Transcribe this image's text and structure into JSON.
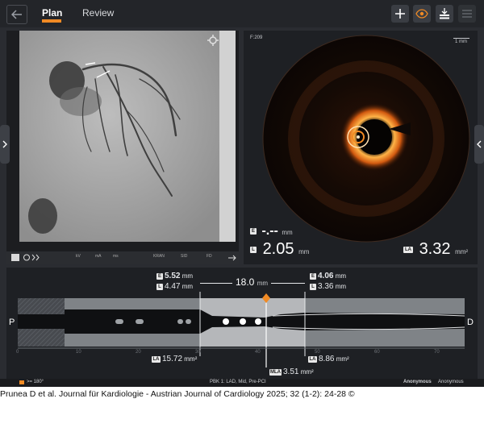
{
  "tabs": {
    "plan": "Plan",
    "review": "Review"
  },
  "angio": {
    "bottom_labels": [
      "kV",
      "mA",
      "ms",
      "KRAN",
      "SID",
      "FD"
    ]
  },
  "oct": {
    "frame": "F:209",
    "scale": "1 mm",
    "e_value": "-.--",
    "e_unit": "mm",
    "l_value": "2.05",
    "l_unit": "mm",
    "la_value": "3.32",
    "la_unit": "mm²"
  },
  "longitudinal": {
    "left_e": "5.52",
    "left_l": "4.47",
    "right_e": "4.06",
    "right_l": "3.36",
    "length": "18.0",
    "unit_mm": "mm",
    "left_la": "15.72",
    "right_la": "8.86",
    "mla": "3.51",
    "unit_mm2": "mm²",
    "proximal": "P",
    "distal": "D",
    "ticks": [
      "0",
      "10",
      "20",
      "30",
      "40",
      "50",
      "60",
      "70"
    ]
  },
  "status": {
    "legend": ">= 180°",
    "info": "PBK 1: LAD, Mid, Pre-PCI",
    "anon1": "Anonymous",
    "anon2": "Anonymous"
  },
  "caption": "Prunea D et al. Journal für Kardiologie - Austrian Journal of Cardiology 2025; 32 (1-2): 24-28 ©",
  "colors": {
    "accent": "#f08a24",
    "background": "#2a2c31",
    "panel": "#1e2024"
  }
}
